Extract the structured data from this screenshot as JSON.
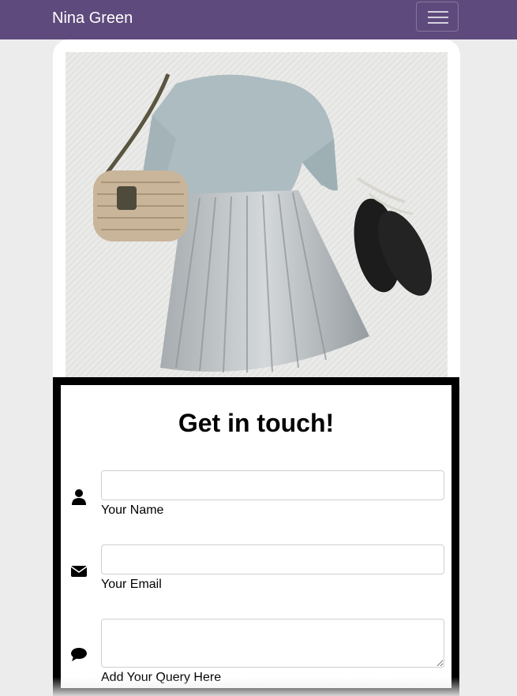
{
  "navbar": {
    "brand": "Nina Green",
    "toggle_icon": "hamburger-menu-icon"
  },
  "hero": {
    "image_subject": "outfit-flatlay",
    "background_color": "#e7e7e5"
  },
  "contact": {
    "heading": "Get in touch!",
    "fields": [
      {
        "icon": "user-icon",
        "label": "Your Name",
        "value": ""
      },
      {
        "icon": "envelope-icon",
        "label": "Your Email",
        "value": ""
      },
      {
        "icon": "comment-icon",
        "label": "Add Your Query Here",
        "value": ""
      }
    ]
  },
  "colors": {
    "navbar": "#5e4a7c",
    "page_background": "#ececec",
    "frame_border": "#000000"
  }
}
